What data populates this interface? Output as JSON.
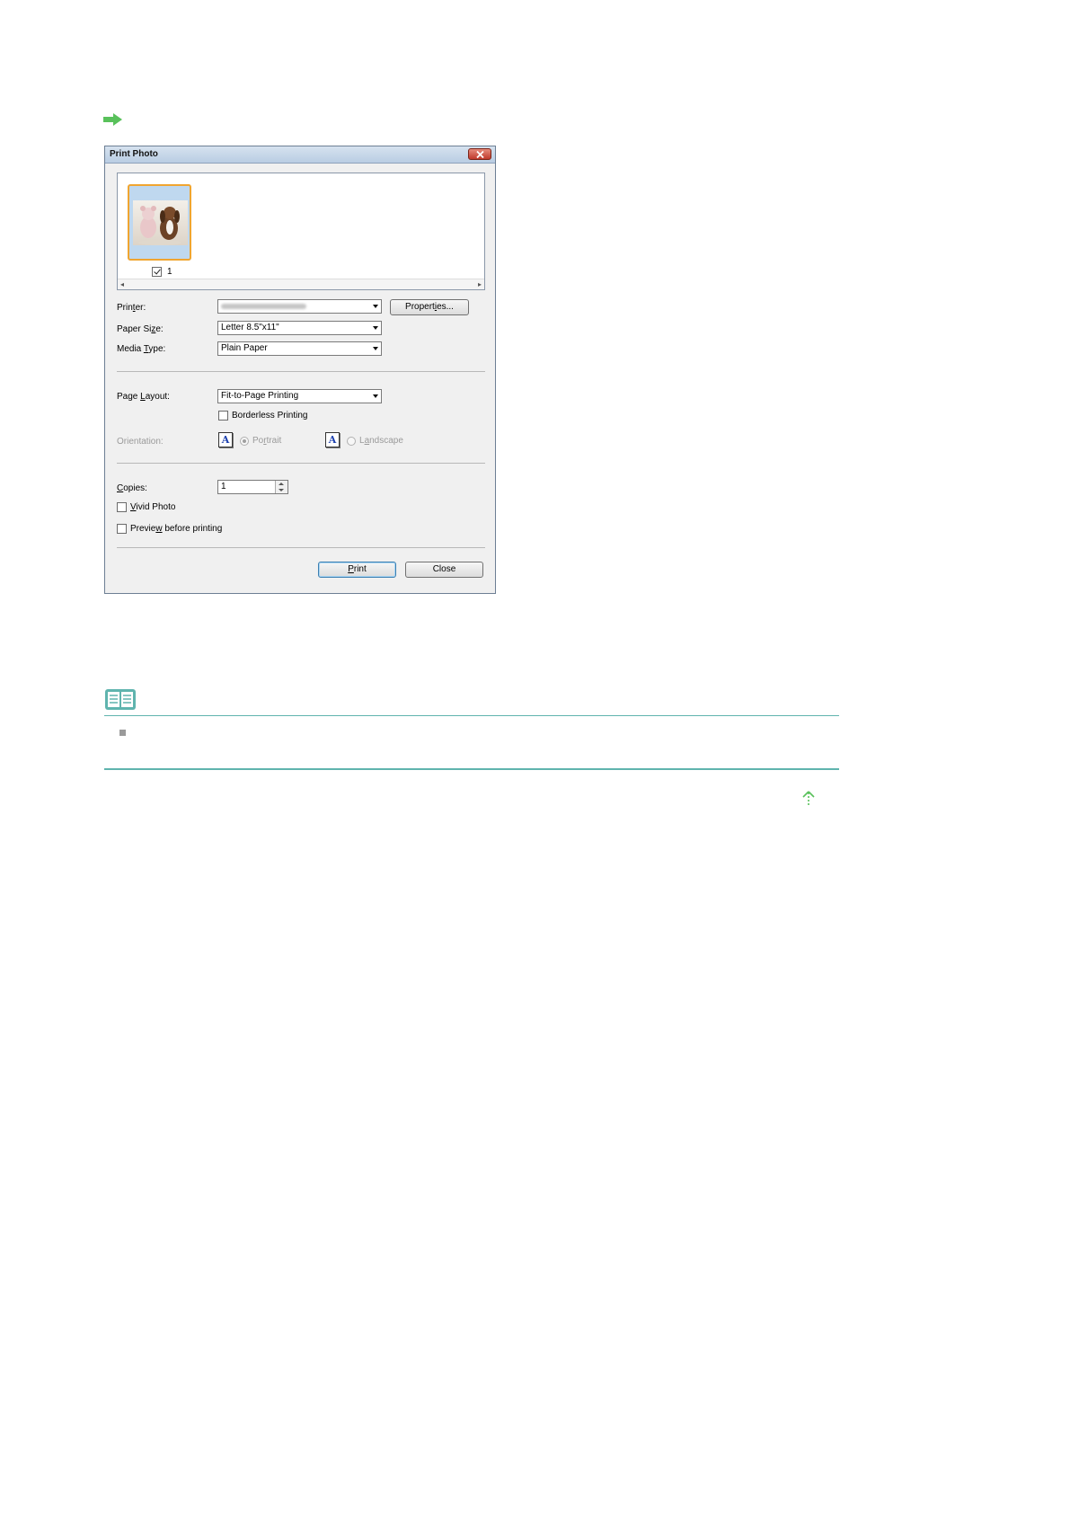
{
  "dialog": {
    "title": "Print Photo",
    "thumbnail": {
      "index": "1",
      "checked": true
    },
    "printer": {
      "label": "Printer:",
      "value": ""
    },
    "properties_button": "Properties...",
    "paper_size": {
      "label": "Paper Size:",
      "value": "Letter 8.5\"x11\""
    },
    "media_type": {
      "label": "Media Type:",
      "value": "Plain Paper"
    },
    "page_layout": {
      "label": "Page Layout:",
      "value": "Fit-to-Page Printing"
    },
    "borderless": {
      "label": "Borderless Printing",
      "checked": false
    },
    "orientation": {
      "label": "Orientation:",
      "portrait": {
        "label": "Portrait",
        "icon_letter": "A",
        "selected": true
      },
      "landscape": {
        "label": "Landscape",
        "icon_letter": "A",
        "selected": false
      }
    },
    "copies": {
      "label": "Copies:",
      "value": "1"
    },
    "vivid_photo": {
      "label": "Vivid Photo",
      "checked": false
    },
    "preview": {
      "label": "Preview before printing",
      "checked": false
    },
    "print_button": "Print",
    "close_button": "Close"
  },
  "colors": {
    "accent_green": "#59c15b",
    "note_line": "#5fb4ae",
    "thumb_border": "#f0a530"
  }
}
